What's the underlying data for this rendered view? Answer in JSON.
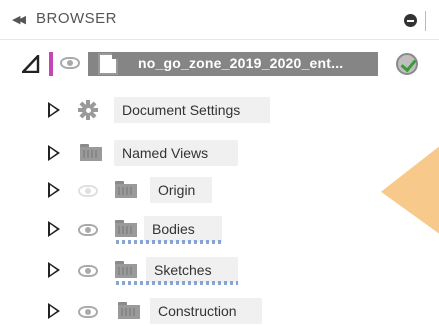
{
  "header": {
    "title": "BROWSER",
    "collapse_icon": "double-chevron-left-icon",
    "menu_icon": "circle-minus-icon"
  },
  "root": {
    "label": "no_go_zone_2019_2020_ent...",
    "expanded": true,
    "visible": true,
    "status_icon": "check-circle-icon"
  },
  "items": [
    {
      "label": "Document Settings",
      "icon": "gear-icon",
      "eye": "none",
      "underline": false
    },
    {
      "label": "Named Views",
      "icon": "folder-icon",
      "eye": "none",
      "underline": false
    },
    {
      "label": "Origin",
      "icon": "folder-icon",
      "eye": "faded",
      "underline": false
    },
    {
      "label": "Bodies",
      "icon": "folder-icon",
      "eye": "visible",
      "underline": true
    },
    {
      "label": "Sketches",
      "icon": "folder-icon",
      "eye": "visible",
      "underline": true
    },
    {
      "label": "Construction",
      "icon": "folder-icon",
      "eye": "visible",
      "underline": false
    }
  ],
  "colors": {
    "active_marker": "#c445b6",
    "root_background": "#858585",
    "accent": "#f7c98a",
    "check": "#3a9a3a"
  }
}
